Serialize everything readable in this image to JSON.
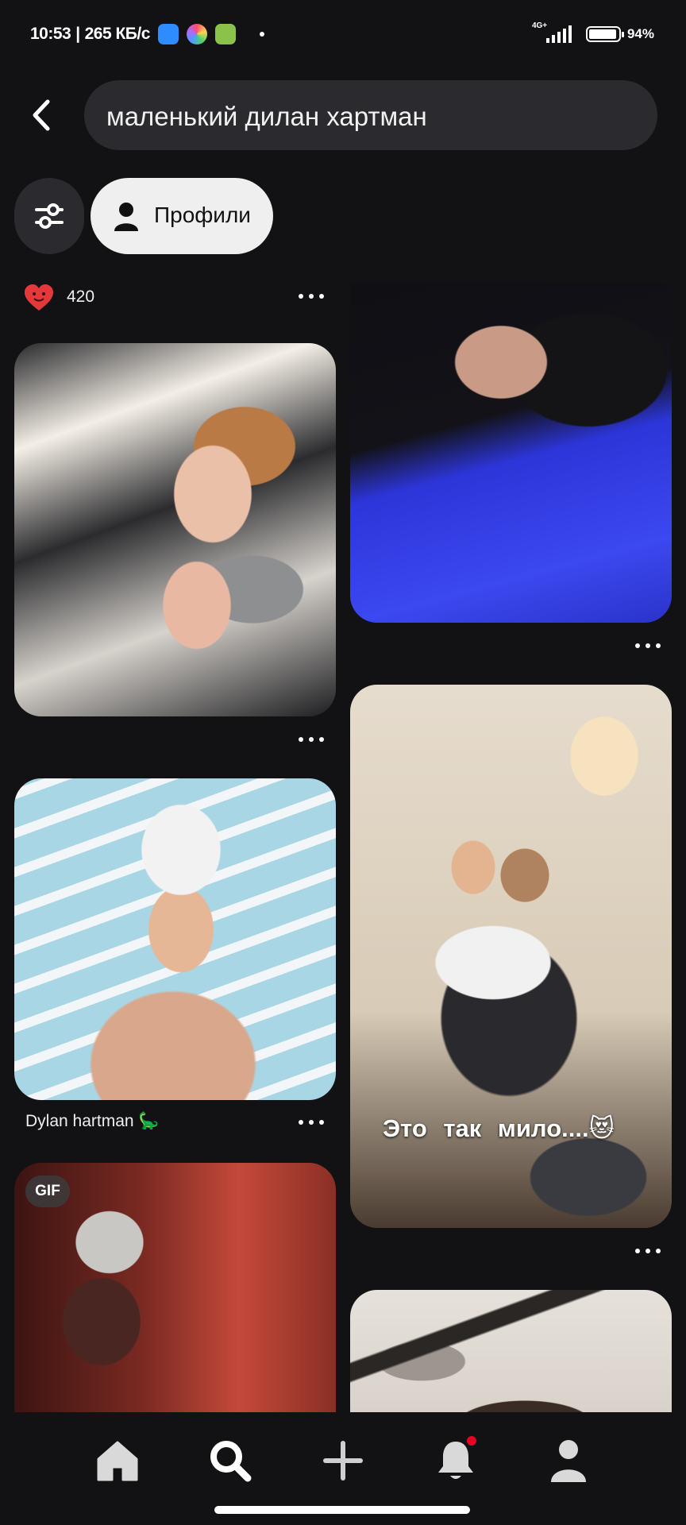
{
  "status_bar": {
    "time": "10:53",
    "speed": "265 КБ/с",
    "network": "4G+",
    "battery": "94%"
  },
  "search": {
    "query": "маленький дилан хартман"
  },
  "filters": {
    "profiles_label": "Профили"
  },
  "pins": {
    "left_top": {
      "likes": "420"
    },
    "left_middle": {
      "title": "Dylan hartman 🦕"
    },
    "left_bottom": {
      "badge": "GIF"
    },
    "right_middle": {
      "caption": "Это так мило....😻"
    }
  },
  "nav": {
    "items": [
      "home-icon",
      "search-icon",
      "add-icon",
      "notifications-icon",
      "profile-icon"
    ],
    "active": "search-icon",
    "notification_dot": true
  },
  "colors": {
    "background": "#121114",
    "chip": "#2b2a2e",
    "accent": "#e60023",
    "heart": "#e5383b"
  }
}
